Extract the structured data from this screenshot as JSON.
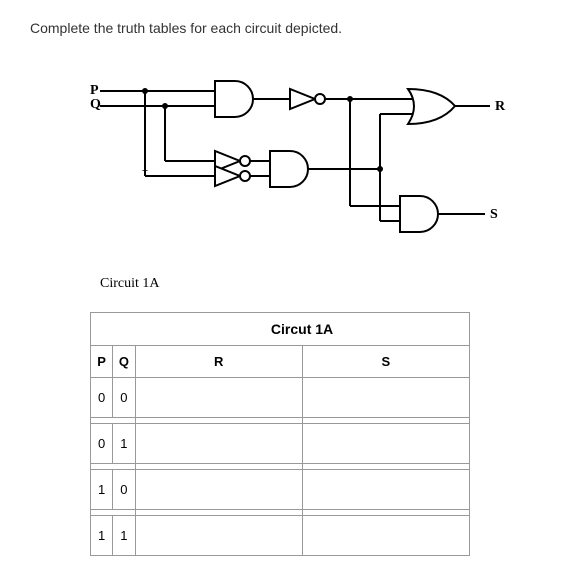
{
  "instruction": "Complete the truth tables for each circuit depicted.",
  "circuit": {
    "name": "Circuit 1A",
    "inputs": {
      "p": "P",
      "q": "Q"
    },
    "outputs": {
      "r": "R",
      "s": "S"
    }
  },
  "table": {
    "title": "Circut 1A",
    "headers": {
      "p": "P",
      "q": "Q",
      "r": "R",
      "s": "S"
    },
    "rows": [
      {
        "p": "0",
        "q": "0",
        "r": "",
        "s": ""
      },
      {
        "p": "0",
        "q": "1",
        "r": "",
        "s": ""
      },
      {
        "p": "1",
        "q": "0",
        "r": "",
        "s": ""
      },
      {
        "p": "1",
        "q": "1",
        "r": "",
        "s": ""
      }
    ]
  }
}
